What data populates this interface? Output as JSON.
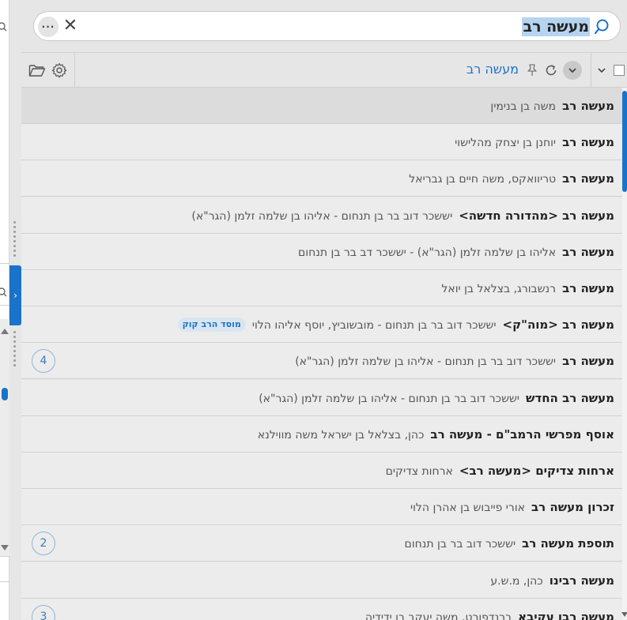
{
  "search": {
    "query": "מעשה רב",
    "more_label": "···",
    "clear_label": "✕"
  },
  "toolbar": {
    "tab_label": "מעשה רב"
  },
  "edge_tab": {
    "label": "›"
  },
  "results": [
    {
      "title": "מעשה רב",
      "author": "משה בן בנימין",
      "badge": null,
      "count": null
    },
    {
      "title": "מעשה רב",
      "author": "יוחנן בן יצחק מהלישוי",
      "badge": null,
      "count": null
    },
    {
      "title": "מעשה רב",
      "author": "טריוואקס, משה חיים בן גבריאל",
      "badge": null,
      "count": null
    },
    {
      "title": "מעשה רב <מהדורה חדשה>",
      "author": "יששכר דוב בר בן תנחום - אליהו בן שלמה זלמן (הגר\"א)",
      "badge": null,
      "count": null
    },
    {
      "title": "מעשה רב",
      "author": "אליהו בן שלמה זלמן (הגר\"א) - יששכר דב בר בן תנחום",
      "badge": null,
      "count": null
    },
    {
      "title": "מעשה רב",
      "author": "רנשבורג, בצלאל בן יואל",
      "badge": null,
      "count": null
    },
    {
      "title": "מעשה רב <מוה\"ק>",
      "author": "יששכר דוב בר בן תנחום - מובשוביץ, יוסף אליהו הלוי",
      "badge": "מוסד הרב קוק",
      "count": null
    },
    {
      "title": "מעשה רב",
      "author": "יששכר דוב בר בן תנחום - אליהו בן שלמה זלמן (הגר\"א)",
      "badge": null,
      "count": "4"
    },
    {
      "title": "מעשה רב החדש",
      "author": "יששכר דוב בר בן תנחום - אליהו בן שלמה זלמן (הגר\"א)",
      "badge": null,
      "count": null
    },
    {
      "title": "אוסף מפרשי הרמב\"ם - מעשה רב",
      "author": "כהן, בצלאל בן ישראל משה מווילנא",
      "badge": null,
      "count": null
    },
    {
      "title": "ארחות צדיקים <מעשה רב>",
      "author": "ארחות צדיקים",
      "badge": null,
      "count": null
    },
    {
      "title": "זכרון מעשה רב",
      "author": "אורי פייבוש בן אהרן הלוי",
      "badge": null,
      "count": null
    },
    {
      "title": "תוספת מעשה רב",
      "author": "יששכר דוב בר בן תנחום",
      "badge": null,
      "count": "2"
    },
    {
      "title": "מעשה רבינו",
      "author": "כהן, מ.ש.ע",
      "badge": null,
      "count": null
    },
    {
      "title": "מעשה רבן עקיבא",
      "author": "ברנדפורט, משה יעקב בן ידידיה",
      "badge": null,
      "count": "3"
    }
  ],
  "colors": {
    "accent": "#1a73c9",
    "selection": "#b6d4f0",
    "row_selected": "#dcdcdc",
    "row_bg": "#ececec"
  }
}
